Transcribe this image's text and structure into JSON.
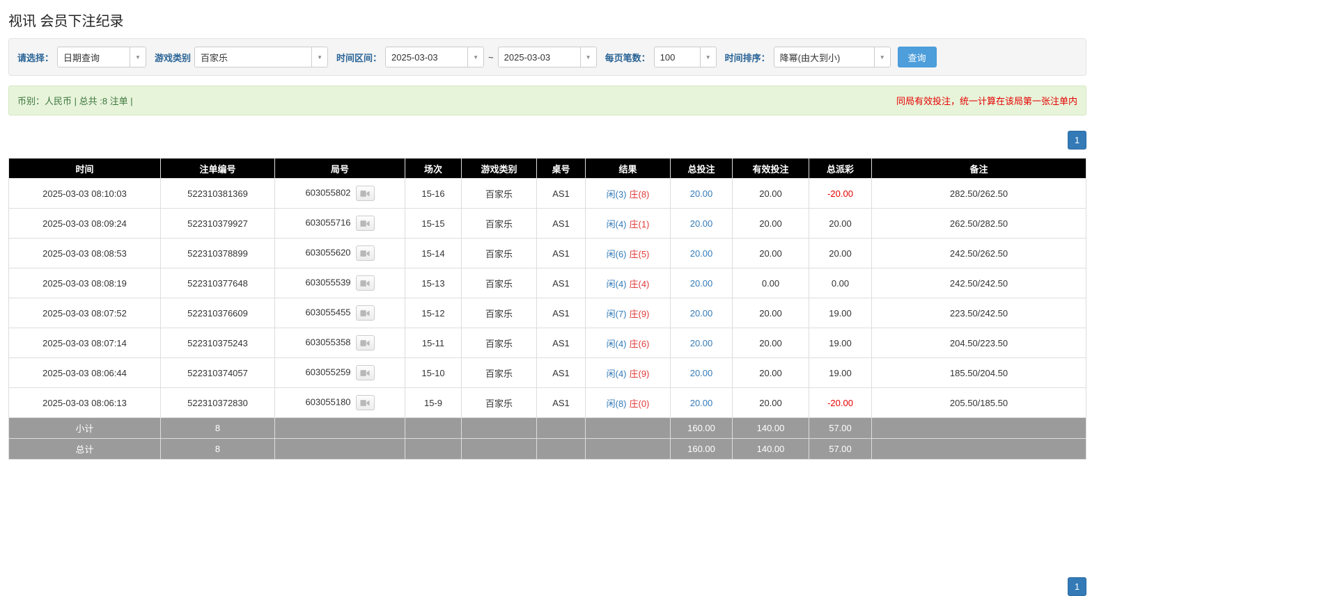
{
  "page": {
    "title": "视讯 会员下注纪录"
  },
  "icons": {
    "chevron_down": "▼",
    "round_media": "video-camera"
  },
  "colors": {
    "header_bg": "#000000",
    "footer_bg": "#9b9b9b",
    "link_blue": "#337ab7",
    "player_blue": "#337ab7",
    "banker_red": "#e03a3a",
    "negative_red": "#e60000",
    "notice_bg": "#e7f4da",
    "warning_red": "#e60000",
    "search_button_blue": "#4d9edb",
    "pagination_blue": "#337ab7"
  },
  "filters": {
    "select_label": "请选择：",
    "select_value": "日期查询",
    "game_label": "游戏类别",
    "game_value": "百家乐",
    "range_label": "时间区间：",
    "date_from": "2025-03-03",
    "range_separator": "~",
    "date_to": "2025-03-03",
    "page_size_label": "每页笔数：",
    "page_size_value": "100",
    "sort_label": "时间排序：",
    "sort_value": "降幂(由大到小)",
    "search_button": "查询"
  },
  "notice": {
    "currency_info": "币别：人民币 | 总共 :8 注单 |",
    "warning": "同局有效投注，统一计算在该局第一张注单内"
  },
  "pagination": {
    "current": "1"
  },
  "table": {
    "headers": [
      "时间",
      "注单编号",
      "局号",
      "场次",
      "游戏类别",
      "桌号",
      "结果",
      "总投注",
      "有效投注",
      "总派彩",
      "备注"
    ],
    "rows": [
      {
        "time": "2025-03-03 08:10:03",
        "bet_no": "522310381369",
        "round_no": "603055802",
        "session": "15-16",
        "game": "百家乐",
        "table_no": "AS1",
        "result_player": "闲(3)",
        "result_banker": "庄(8)",
        "total_bet": "20.00",
        "valid_bet": "20.00",
        "payout": "-20.00",
        "remark": "282.50/262.50"
      },
      {
        "time": "2025-03-03 08:09:24",
        "bet_no": "522310379927",
        "round_no": "603055716",
        "session": "15-15",
        "game": "百家乐",
        "table_no": "AS1",
        "result_player": "闲(4)",
        "result_banker": "庄(1)",
        "total_bet": "20.00",
        "valid_bet": "20.00",
        "payout": "20.00",
        "remark": "262.50/282.50"
      },
      {
        "time": "2025-03-03 08:08:53",
        "bet_no": "522310378899",
        "round_no": "603055620",
        "session": "15-14",
        "game": "百家乐",
        "table_no": "AS1",
        "result_player": "闲(6)",
        "result_banker": "庄(5)",
        "total_bet": "20.00",
        "valid_bet": "20.00",
        "payout": "20.00",
        "remark": "242.50/262.50"
      },
      {
        "time": "2025-03-03 08:08:19",
        "bet_no": "522310377648",
        "round_no": "603055539",
        "session": "15-13",
        "game": "百家乐",
        "table_no": "AS1",
        "result_player": "闲(4)",
        "result_banker": "庄(4)",
        "total_bet": "20.00",
        "valid_bet": "0.00",
        "payout": "0.00",
        "remark": "242.50/242.50"
      },
      {
        "time": "2025-03-03 08:07:52",
        "bet_no": "522310376609",
        "round_no": "603055455",
        "session": "15-12",
        "game": "百家乐",
        "table_no": "AS1",
        "result_player": "闲(7)",
        "result_banker": "庄(9)",
        "total_bet": "20.00",
        "valid_bet": "20.00",
        "payout": "19.00",
        "remark": "223.50/242.50"
      },
      {
        "time": "2025-03-03 08:07:14",
        "bet_no": "522310375243",
        "round_no": "603055358",
        "session": "15-11",
        "game": "百家乐",
        "table_no": "AS1",
        "result_player": "闲(4)",
        "result_banker": "庄(6)",
        "total_bet": "20.00",
        "valid_bet": "20.00",
        "payout": "19.00",
        "remark": "204.50/223.50"
      },
      {
        "time": "2025-03-03 08:06:44",
        "bet_no": "522310374057",
        "round_no": "603055259",
        "session": "15-10",
        "game": "百家乐",
        "table_no": "AS1",
        "result_player": "闲(4)",
        "result_banker": "庄(9)",
        "total_bet": "20.00",
        "valid_bet": "20.00",
        "payout": "19.00",
        "remark": "185.50/204.50"
      },
      {
        "time": "2025-03-03 08:06:13",
        "bet_no": "522310372830",
        "round_no": "603055180",
        "session": "15-9",
        "game": "百家乐",
        "table_no": "AS1",
        "result_player": "闲(8)",
        "result_banker": "庄(0)",
        "total_bet": "20.00",
        "valid_bet": "20.00",
        "payout": "-20.00",
        "remark": "205.50/185.50"
      }
    ],
    "footer": [
      {
        "label": "小计",
        "count": "8",
        "total_bet": "160.00",
        "valid_bet": "140.00",
        "payout": "57.00"
      },
      {
        "label": "总计",
        "count": "8",
        "total_bet": "160.00",
        "valid_bet": "140.00",
        "payout": "57.00"
      }
    ]
  }
}
